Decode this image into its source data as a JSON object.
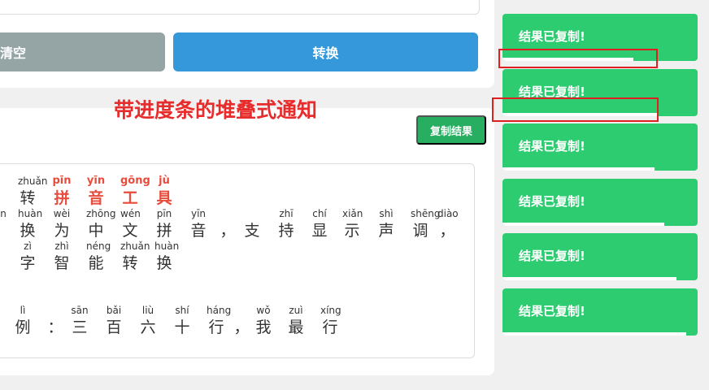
{
  "buttons": {
    "clear_label": "清空",
    "convert_label": "转换",
    "copy_label": "复制结果"
  },
  "headline": "带进度条的堆叠式通知",
  "result": {
    "lines": [
      [
        {
          "py": "",
          "hz": "",
          "hl": false
        },
        {
          "py": "zhuǎn",
          "hz": "转",
          "hl": false
        },
        {
          "py": "pīn",
          "hz": "拼",
          "hl": true
        },
        {
          "py": "yīn",
          "hz": "音",
          "hl": true
        },
        {
          "py": "gōng",
          "hz": "工",
          "hl": true
        },
        {
          "py": "jù",
          "hz": "具",
          "hl": true
        }
      ],
      [
        {
          "py": "n",
          "hz": "",
          "hl": false
        },
        {
          "py": "huàn",
          "hz": "换",
          "hl": false
        },
        {
          "py": "wèi",
          "hz": "为",
          "hl": false
        },
        {
          "py": "zhōng",
          "hz": "中",
          "hl": false
        },
        {
          "py": "wén",
          "hz": "文",
          "hl": false
        },
        {
          "py": "pīn",
          "hz": "拼",
          "hl": false
        },
        {
          "py": "yīn",
          "hz": "音",
          "hl": false
        },
        {
          "py": "",
          "hz": "，",
          "hl": false
        },
        {
          "py": "",
          "hz": "支",
          "hl": false
        },
        {
          "py": "zhī",
          "hz": "持",
          "hl": false
        },
        {
          "py": "chí",
          "hz": "显",
          "hl": false
        },
        {
          "py": "xiǎn",
          "hz": "示",
          "hl": false
        },
        {
          "py": "shì",
          "hz": "声",
          "hl": false
        },
        {
          "py": "shēng",
          "hz": "调",
          "hl": false
        },
        {
          "py": "diào",
          "hz": "，",
          "hl": false
        }
      ],
      [
        {
          "py": "zì",
          "hz": "字",
          "hl": false
        },
        {
          "py": "zhì",
          "hz": "智",
          "hl": false
        },
        {
          "py": "néng",
          "hz": "能",
          "hl": false
        },
        {
          "py": "zhuǎn",
          "hz": "转",
          "hl": false
        },
        {
          "py": "huàn",
          "hz": "换",
          "hl": false
        }
      ],
      [
        {
          "py": "lì",
          "hz": "例",
          "hl": false
        },
        {
          "py": "",
          "hz": "：",
          "hl": false
        },
        {
          "py": "sān",
          "hz": "三",
          "hl": false
        },
        {
          "py": "bǎi",
          "hz": "百",
          "hl": false
        },
        {
          "py": "liù",
          "hz": "六",
          "hl": false
        },
        {
          "py": "shí",
          "hz": "十",
          "hl": false
        },
        {
          "py": "háng",
          "hz": "行",
          "hl": false
        },
        {
          "py": "",
          "hz": "，",
          "hl": false
        },
        {
          "py": "wǒ",
          "hz": "我",
          "hl": false
        },
        {
          "py": "zuì",
          "hz": "最",
          "hl": false
        },
        {
          "py": "xíng",
          "hz": "行",
          "hl": false
        }
      ]
    ]
  },
  "toasts": [
    {
      "message": "结果已复制!",
      "progress": 0.67
    },
    {
      "message": "结果已复制!",
      "progress": 0.8
    },
    {
      "message": "结果已复制!",
      "progress": 0.78
    },
    {
      "message": "结果已复制!",
      "progress": 0.83
    },
    {
      "message": "结果已复制!",
      "progress": 0.89
    },
    {
      "message": "结果已复制!",
      "progress": 0.94
    }
  ],
  "colors": {
    "toast": "#2ecc71",
    "convert": "#3498db",
    "clear": "#95a5a6",
    "copy": "#27ae60",
    "highlight": "#e74c3c",
    "headline": "#e82b2b"
  }
}
